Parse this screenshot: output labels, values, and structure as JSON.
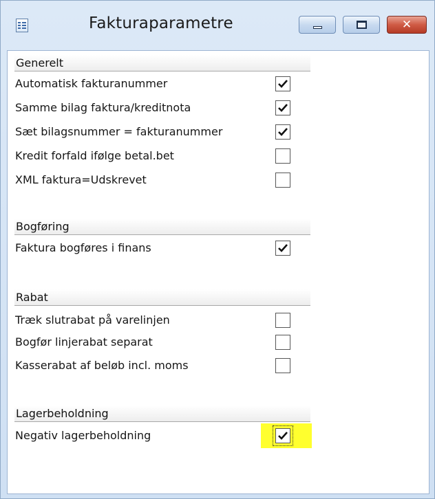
{
  "window": {
    "title": "Fakturaparametre",
    "title_icon": "form-icon",
    "controls": {
      "minimize_icon": "minimize-icon",
      "maximize_icon": "maximize-icon",
      "close_icon": "close-icon",
      "close_glyph": "✕"
    },
    "colors": {
      "frame": "#d7e6f6",
      "close_button": "#c8432c",
      "highlight": "#ffff2e"
    }
  },
  "sections": {
    "generelt": {
      "header": "Generelt",
      "items": [
        {
          "label": "Automatisk fakturanummer",
          "checked": true
        },
        {
          "label": "Samme bilag faktura/kreditnota",
          "checked": true
        },
        {
          "label": "Sæt bilagsnummer = fakturanummer",
          "checked": true
        },
        {
          "label": "Kredit forfald ifølge betal.bet",
          "checked": false
        },
        {
          "label": "XML faktura=Udskrevet",
          "checked": false
        }
      ]
    },
    "bogforing": {
      "header": "Bogføring",
      "items": [
        {
          "label": "Faktura bogføres i finans",
          "checked": true
        }
      ]
    },
    "rabat": {
      "header": "Rabat",
      "items": [
        {
          "label": "Træk slutrabat på varelinjen",
          "checked": false
        },
        {
          "label": "Bogfør linjerabat separat",
          "checked": false
        },
        {
          "label": "Kasserabat af beløb incl. moms",
          "checked": false
        }
      ]
    },
    "lagerbeholdning": {
      "header": "Lagerbeholdning",
      "items": [
        {
          "label": "Negativ lagerbeholdning",
          "checked": true,
          "highlighted": true,
          "focused": true
        }
      ]
    }
  }
}
